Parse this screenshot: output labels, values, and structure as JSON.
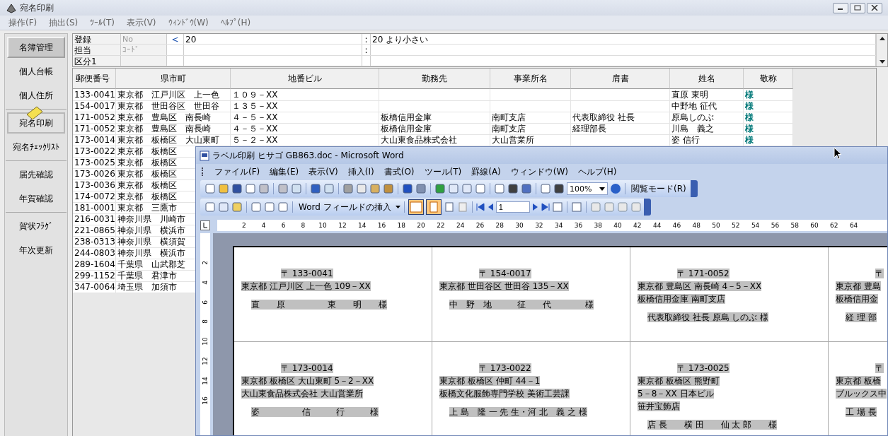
{
  "app": {
    "title": "宛名印刷",
    "menu": [
      "操作(F)",
      "抽出(S)",
      "ﾂｰﾙ(T)",
      "表示(V)",
      "ｳｨﾝﾄﾞｳ(W)",
      "ﾍﾙﾌﾟ(H)"
    ]
  },
  "sidebar": {
    "groups": [
      [
        {
          "label": "名簿管理",
          "selected": true,
          "focused": false
        },
        {
          "label": "個人台帳",
          "selected": false,
          "focused": false
        },
        {
          "label": "個人住所",
          "selected": false,
          "focused": false
        }
      ],
      [
        {
          "label": "宛名印刷",
          "selected": false,
          "focused": true
        },
        {
          "label": "宛名ﾁｪｯｸﾘｽﾄ",
          "selected": false,
          "focused": false
        }
      ],
      [
        {
          "label": "届先確認",
          "selected": false,
          "focused": false
        },
        {
          "label": "年賀確認",
          "selected": false,
          "focused": false
        }
      ],
      [
        {
          "label": "賀状ﾌﾗｸﾞ",
          "selected": false,
          "focused": false
        },
        {
          "label": "年次更新",
          "selected": false,
          "focused": false
        }
      ]
    ]
  },
  "filter": {
    "rows": [
      {
        "field": "登録",
        "placeholder": "No",
        "operator": "<",
        "value": "20",
        "separator": ":",
        "description": "20 より小さい"
      },
      {
        "field": "担当",
        "placeholder": "ｺｰﾄﾞ",
        "separator": ":"
      },
      {
        "field": "区分1"
      }
    ]
  },
  "table": {
    "columns": [
      "郵便番号",
      "県市町",
      "地番ビル",
      "勤務先",
      "事業所名",
      "肩書",
      "姓名",
      "敬称"
    ],
    "rows": [
      {
        "postal": "133-0041",
        "city": "東京都　江戸川区　上一色",
        "address": "１０９－XX",
        "name": "直原 東明",
        "honorific": "様"
      },
      {
        "postal": "154-0017",
        "city": "東京都　世田谷区　世田谷",
        "address": "１３５－XX",
        "name": "中野地 征代",
        "honorific": "様"
      },
      {
        "postal": "171-0052",
        "city": "東京都　豊島区　南長崎",
        "address": "４－５－XX",
        "employer": "板橋信用金庫",
        "office": "南町支店",
        "title": "代表取締役 社長",
        "name": "原島しのぶ",
        "honorific": "様"
      },
      {
        "postal": "171-0052",
        "city": "東京都　豊島区　南長崎",
        "address": "４－５－XX",
        "employer": "板橋信用金庫",
        "office": "南町支店",
        "title": "経理部長",
        "name": "川島　義之",
        "honorific": "様"
      },
      {
        "postal": "173-0014",
        "city": "東京都　板橋区　大山東町",
        "address": "５－２－XX",
        "employer": "大山東食品株式会社",
        "office": "大山営業所",
        "name": "姿 信行",
        "honorific": "様"
      },
      {
        "postal": "173-0022",
        "city": "東京都　板橋区"
      },
      {
        "postal": "173-0025",
        "city": "東京都　板橋区"
      },
      {
        "postal": "173-0026",
        "city": "東京都　板橋区"
      },
      {
        "postal": "173-0036",
        "city": "東京都　板橋区"
      },
      {
        "postal": "174-0072",
        "city": "東京都　板橋区"
      },
      {
        "postal": "181-0001",
        "city": "東京都　三鷹市"
      },
      {
        "postal": "216-0031",
        "city": "神奈川県　川崎市"
      },
      {
        "postal": "221-0865",
        "city": "神奈川県　横浜市"
      },
      {
        "postal": "238-0313",
        "city": "神奈川県　横須賀"
      },
      {
        "postal": "244-0803",
        "city": "神奈川県　横浜市"
      },
      {
        "postal": "289-1604",
        "city": "千葉県　山武郡芝"
      },
      {
        "postal": "299-1152",
        "city": "千葉県　君津市"
      },
      {
        "postal": "347-0064",
        "city": "埼玉県　加須市"
      }
    ]
  },
  "word": {
    "title": "ラベル印刷 ヒサゴ GB863.doc - Microsoft Word",
    "menu": [
      "ファイル(F)",
      "編集(E)",
      "表示(V)",
      "挿入(I)",
      "書式(O)",
      "ツール(T)",
      "罫線(A)",
      "ウィンドウ(W)",
      "ヘルプ(H)"
    ],
    "zoom": "100%",
    "reading_mode": "閲覧モード(R)",
    "insert_field": "Word フィールドの挿入",
    "record": "1",
    "ruler": [
      "2",
      "4",
      "6",
      "8",
      "10",
      "12",
      "14",
      "16",
      "18",
      "20",
      "22",
      "24",
      "26",
      "28",
      "30",
      "32",
      "34",
      "36",
      "38",
      "40",
      "42",
      "44",
      "46",
      "48",
      "50",
      "52",
      "54",
      "56",
      "58",
      "60",
      "62",
      "64"
    ],
    "vruler": [
      "2",
      "4",
      "6",
      "8",
      "10",
      "12",
      "14",
      "16"
    ],
    "labels": [
      [
        {
          "postal": "〒 133-0041",
          "lines": [
            "東京都 江戸川区 上一色 109－XX"
          ],
          "name": "直　　原　　　　　東　　明　　様"
        },
        {
          "postal": "〒 154-0017",
          "lines": [
            "東京都 世田谷区 世田谷 135－XX"
          ],
          "name": "中　野　地　　　征　　代　　　　様"
        },
        {
          "postal": "〒 171-0052",
          "lines": [
            "東京都 豊島区 南長崎 4－5－XX",
            "板橋信用金庫 南町支店"
          ],
          "name": "代表取締役 社長 原島 しのぶ 様"
        },
        {
          "postal": "〒",
          "lines": [
            "東京都 豊島",
            "板橋信用金"
          ],
          "name": "経 理 部"
        }
      ],
      [
        {
          "postal": "〒 173-0014",
          "lines": [
            "東京都 板橋区 大山東町 5－2－XX",
            "大山東食品株式会社 大山営業所"
          ],
          "name": "姿　　　　　信　　　行　　　様"
        },
        {
          "postal": "〒 173-0022",
          "lines": [
            "東京都 板橋区 仲町 44－1",
            "板橋文化服飾専門学校 美術工芸課"
          ],
          "name": "上 島　隆 一 先 生・河 北　義 之 様"
        },
        {
          "postal": "〒 173-0025",
          "lines": [
            "東京都 板橋区 熊野町",
            "5－8－XX 日本ビル",
            "笹井宝飾店"
          ],
          "name": "店 長　　横 田　　仙 太 郎　　様"
        },
        {
          "postal": "〒",
          "lines": [
            "東京都 板橋",
            "ブルックス中"
          ],
          "name": "工 場 長"
        }
      ]
    ]
  }
}
